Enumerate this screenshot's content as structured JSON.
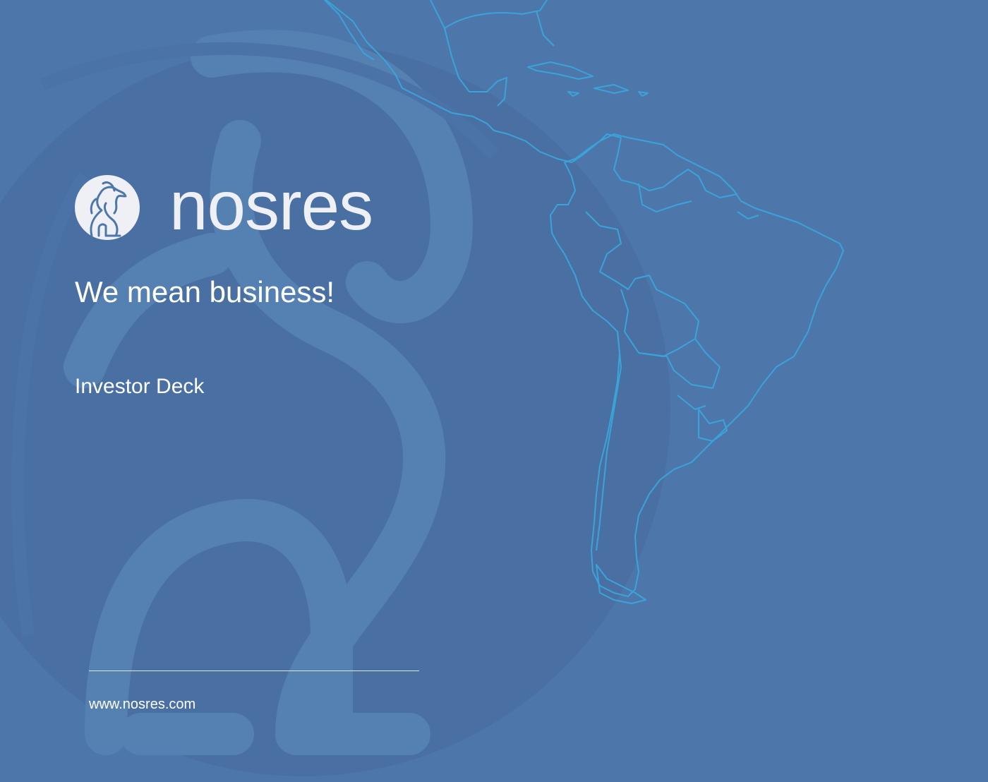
{
  "brand": {
    "name": "nosres",
    "logo_icon": "lion-logo-icon"
  },
  "tagline": "We mean business!",
  "subtitle": "Investor Deck",
  "footer": {
    "website": "www.nosres.com"
  },
  "map": {
    "region": "Latin America",
    "stroke_color": "#3aa3d8"
  },
  "colors": {
    "background": "#4d77aa",
    "text": "#ffffff",
    "logo_bg": "#eef0f5"
  }
}
